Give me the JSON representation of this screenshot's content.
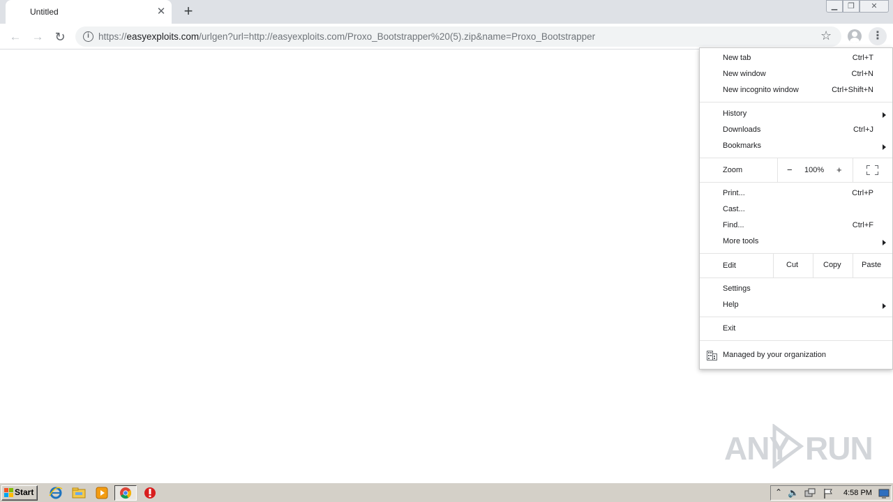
{
  "tab": {
    "title": "Untitled"
  },
  "toolbar": {
    "url_prefix": "https://",
    "url_domain": "easyexploits.com",
    "url_rest": "/urlgen?url=http://easyexploits.com/Proxo_Bootstrapper%20(5).zip&name=Proxo_Bootstrapper"
  },
  "menu": {
    "new_tab": {
      "label": "New tab",
      "shortcut": "Ctrl+T"
    },
    "new_window": {
      "label": "New window",
      "shortcut": "Ctrl+N"
    },
    "new_incognito": {
      "label": "New incognito window",
      "shortcut": "Ctrl+Shift+N"
    },
    "history": {
      "label": "History"
    },
    "downloads": {
      "label": "Downloads",
      "shortcut": "Ctrl+J"
    },
    "bookmarks": {
      "label": "Bookmarks"
    },
    "zoom": {
      "label": "Zoom",
      "minus": "−",
      "level": "100%",
      "plus": "+"
    },
    "print": {
      "label": "Print...",
      "shortcut": "Ctrl+P"
    },
    "cast": {
      "label": "Cast..."
    },
    "find": {
      "label": "Find...",
      "shortcut": "Ctrl+F"
    },
    "more_tools": {
      "label": "More tools"
    },
    "edit": {
      "label": "Edit",
      "cut": "Cut",
      "copy": "Copy",
      "paste": "Paste"
    },
    "settings": {
      "label": "Settings"
    },
    "help": {
      "label": "Help"
    },
    "exit": {
      "label": "Exit"
    },
    "managed": {
      "label": "Managed by your organization"
    }
  },
  "watermark": {
    "left": "ANY",
    "right": "RUN"
  },
  "taskbar": {
    "start_label": "Start",
    "clock": "4:58 PM"
  },
  "colors": {
    "tabstrip": "#dee1e6",
    "omnibox": "#f1f3f4",
    "taskbar": "#d4d0c8",
    "menu_border": "#c8c8c8"
  }
}
